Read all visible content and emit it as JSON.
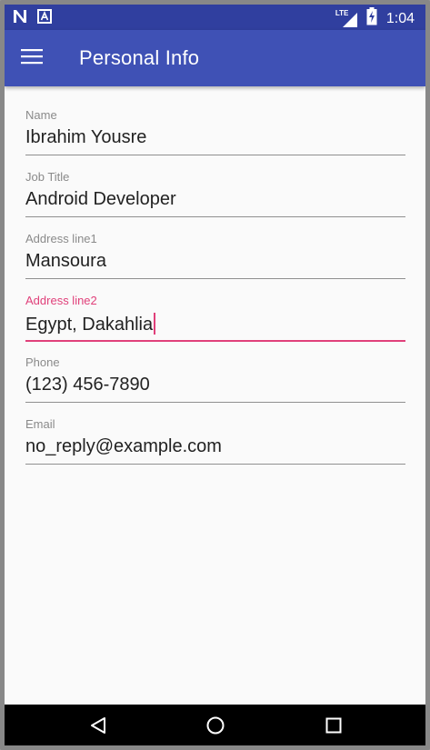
{
  "status_bar": {
    "time": "1:04",
    "network_label": "LTE",
    "icons": [
      "n-notification-icon",
      "a-notification-icon",
      "lte-signal-icon",
      "battery-charging-icon"
    ]
  },
  "app_bar": {
    "title": "Personal Info",
    "menu_icon": "hamburger-menu-icon",
    "background": "#3f51b5",
    "status_background": "#303f9f"
  },
  "form": {
    "accent_color": "#e0407a",
    "fields": [
      {
        "label": "Name",
        "value": "Ibrahim Yousre"
      },
      {
        "label": "Job Title",
        "value": "Android Developer"
      },
      {
        "label": "Address line1",
        "value": "Mansoura"
      },
      {
        "label": "Address line2",
        "value": "Egypt, Dakahlia",
        "focused": true
      },
      {
        "label": "Phone",
        "value": "(123) 456-7890"
      },
      {
        "label": "Email",
        "value": "no_reply@example.com"
      }
    ]
  },
  "nav_bar": {
    "icons": [
      "back-icon",
      "home-icon",
      "recents-icon"
    ]
  }
}
